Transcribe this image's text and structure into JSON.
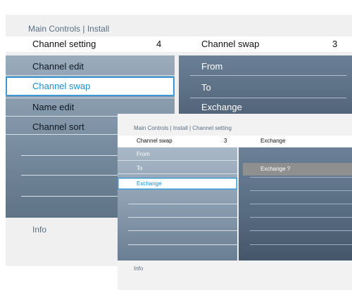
{
  "back_menu": {
    "breadcrumb": "Main Controls | Install",
    "left_header": {
      "label": "Channel setting",
      "value": "4"
    },
    "right_header": {
      "label": "Channel swap",
      "value": "3"
    },
    "left_items": [
      "Channel edit",
      "Channel swap",
      "Name edit",
      "Channel sort"
    ],
    "right_items": [
      "From",
      "To",
      "Exchange"
    ],
    "info": "Info"
  },
  "front_dialog": {
    "breadcrumb": "Main Controls | Install | Channel setting",
    "left_header": {
      "label": "Channel swap",
      "value": "3"
    },
    "right_header": {
      "label": "Exchange"
    },
    "left_items": [
      "From",
      "To",
      "Exchange"
    ],
    "right_item": "Exchange ?",
    "info": "Info"
  },
  "colors": {
    "highlight_border": "#3b9ad6",
    "highlight_text": "#1a8fd5",
    "right_selection": "#8f8f8f"
  }
}
